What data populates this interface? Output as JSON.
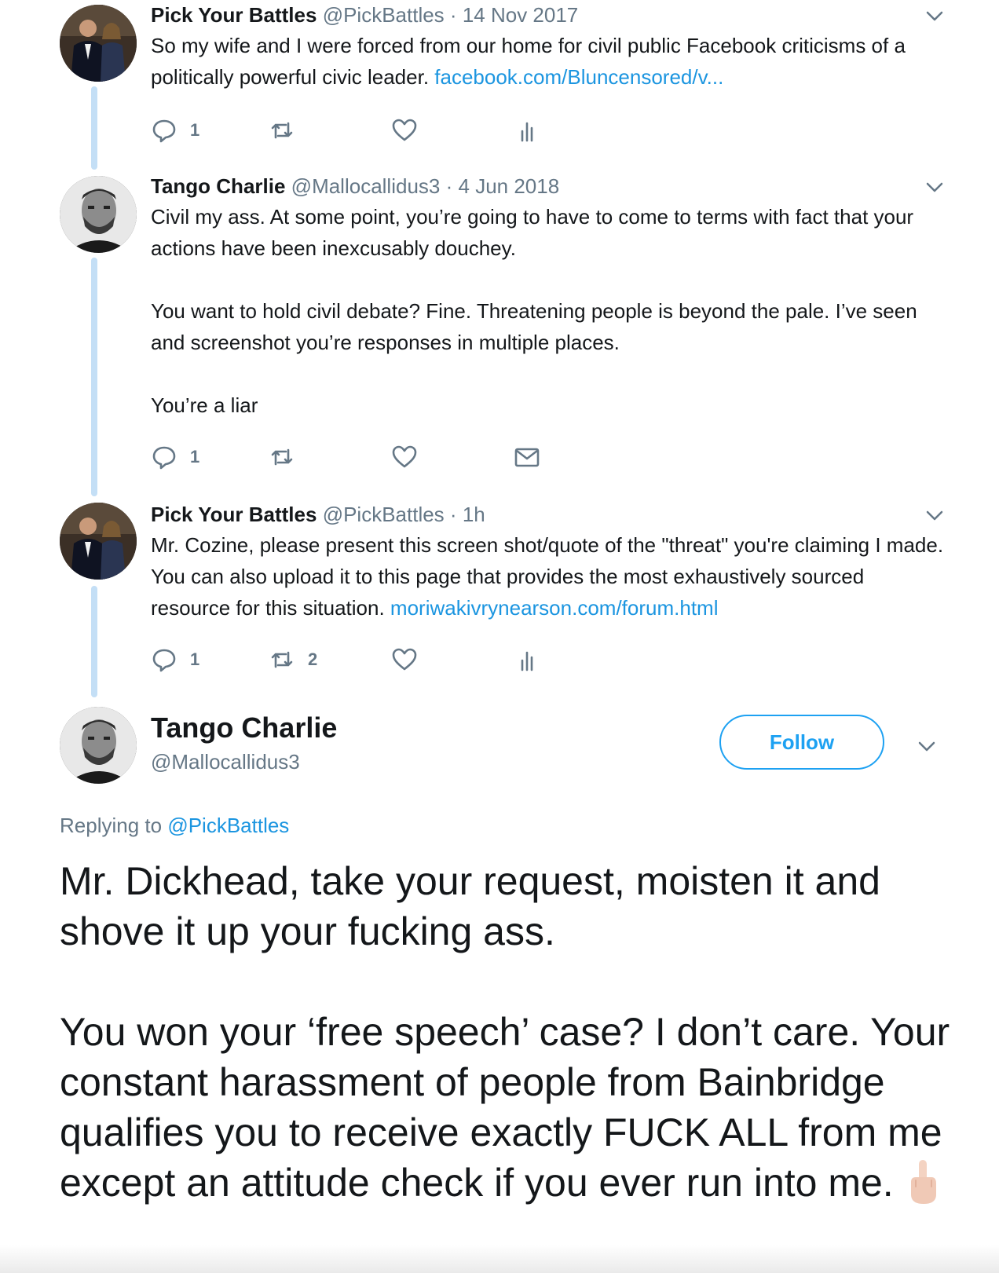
{
  "tweets": [
    {
      "name": "Pick Your Battles",
      "handle": "@PickBattles",
      "separator": "·",
      "time": "14 Nov 2017",
      "text": "So my wife and I were forced from our home for civil public Facebook criticisms of a politically powerful civic leader. ",
      "link": "facebook.com/Bluncensored/v...",
      "replies": "1",
      "retweets": "",
      "likes": "",
      "extra_icon": "analytics-icon"
    },
    {
      "name": "Tango Charlie",
      "handle": "@Mallocallidus3",
      "separator": "·",
      "time": "4 Jun 2018",
      "paragraphs": [
        "Civil my ass. At some point, you’re going to have to come to terms with fact that your actions have been inexcusably douchey.",
        "You want to hold civil debate? Fine. Threatening people is beyond the pale. I’ve seen and screenshot you’re responses in multiple places.",
        "You’re a liar"
      ],
      "replies": "1",
      "retweets": "",
      "likes": "",
      "extra_icon": "message-icon"
    },
    {
      "name": "Pick Your Battles",
      "handle": "@PickBattles",
      "separator": "·",
      "time": "1h",
      "text": "Mr. Cozine, please present this screen shot/quote of the \"threat\" you're claiming I made.  You can also upload it to this page that provides the most exhaustively sourced resource for this situation.  ",
      "link": "moriwakivrynearson.com/forum.html",
      "replies": "1",
      "retweets": "2",
      "likes": "",
      "extra_icon": "analytics-icon"
    }
  ],
  "main_tweet": {
    "name": "Tango Charlie",
    "handle": "@Mallocallidus3",
    "follow_label": "Follow",
    "replying_prefix": "Replying to ",
    "replying_handle": "@PickBattles",
    "paragraphs": [
      "Mr. Dickhead, take your request, moisten it and shove it up your fucking ass.",
      "You won your ‘free speech’ case? I don’t care. Your constant harassment of people from Bainbridge qualifies you to receive exactly FUCK ALL from me except an attitude check if you ever run into me."
    ],
    "emoji": "middle-finger-emoji"
  },
  "colors": {
    "text": "#14171a",
    "secondary": "#657786",
    "link": "#1b95e0",
    "accent": "#1da1f2",
    "thread_line": "#c4dff6"
  }
}
